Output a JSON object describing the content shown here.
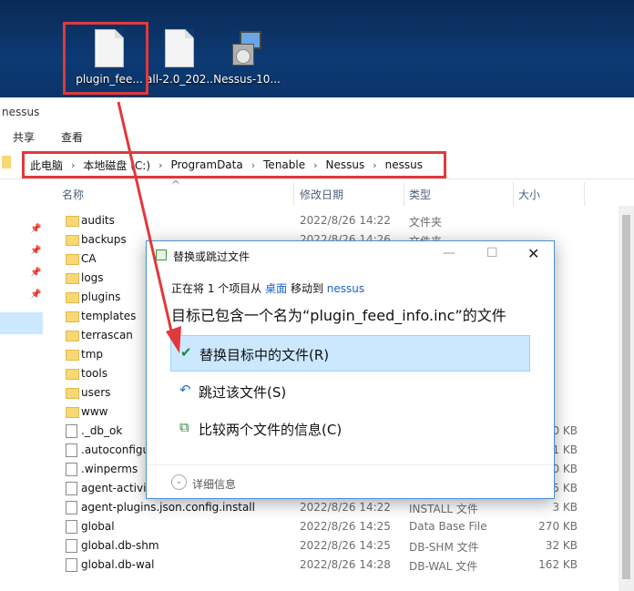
{
  "desktop": {
    "icons": [
      {
        "label": "plugin_fee..."
      },
      {
        "label": "all-2.0_202..."
      },
      {
        "label": "Nessus-10..."
      }
    ]
  },
  "explorer": {
    "window_title_partial": "nessus",
    "ribbon_tabs": [
      "共享",
      "查看"
    ],
    "breadcrumb": [
      "此电脑",
      "本地磁盘 (C:)",
      "ProgramData",
      "Tenable",
      "Nessus",
      "nessus"
    ],
    "columns": {
      "name": "名称",
      "date": "修改日期",
      "type": "类型",
      "size": "大小"
    },
    "rows": [
      {
        "name": "audits",
        "date": "2022/8/26 14:22",
        "type": "文件夹",
        "size": "",
        "kind": "folder"
      },
      {
        "name": "backups",
        "date": "2022/8/26 14:26",
        "type": "文件夹",
        "size": "",
        "kind": "folder"
      },
      {
        "name": "CA",
        "date": "",
        "type": "",
        "size": "",
        "kind": "folder"
      },
      {
        "name": "logs",
        "date": "",
        "type": "",
        "size": "",
        "kind": "folder"
      },
      {
        "name": "plugins",
        "date": "",
        "type": "",
        "size": "",
        "kind": "folder"
      },
      {
        "name": "templates",
        "date": "",
        "type": "",
        "size": "",
        "kind": "folder"
      },
      {
        "name": "terrascan",
        "date": "",
        "type": "",
        "size": "",
        "kind": "folder"
      },
      {
        "name": "tmp",
        "date": "",
        "type": "",
        "size": "",
        "kind": "folder"
      },
      {
        "name": "tools",
        "date": "",
        "type": "",
        "size": "",
        "kind": "folder"
      },
      {
        "name": "users",
        "date": "",
        "type": "",
        "size": "",
        "kind": "folder"
      },
      {
        "name": "www",
        "date": "",
        "type": "",
        "size": "",
        "kind": "folder"
      },
      {
        "name": "._db_ok",
        "date": "",
        "type": "",
        "size": "0 KB",
        "kind": "doc"
      },
      {
        "name": ".autoconfigu",
        "date": "",
        "type": "",
        "size": "1 KB",
        "kind": "doc"
      },
      {
        "name": ".winperms",
        "date": "",
        "type": "",
        "size": "0 KB",
        "kind": "doc"
      },
      {
        "name": "agent-activit",
        "date": "",
        "type": "",
        "size": "5 KB",
        "kind": "doc"
      },
      {
        "name": "agent-plugins.json.config.install",
        "date": "2022/8/26 14:22",
        "type": "INSTALL 文件",
        "size": "3 KB",
        "kind": "doc"
      },
      {
        "name": "global",
        "date": "2022/8/26 14:25",
        "type": "Data Base File",
        "size": "270 KB",
        "kind": "doc"
      },
      {
        "name": "global.db-shm",
        "date": "2022/8/26 14:25",
        "type": "DB-SHM 文件",
        "size": "32 KB",
        "kind": "doc"
      },
      {
        "name": "global.db-wal",
        "date": "2022/8/26 14:28",
        "type": "DB-WAL 文件",
        "size": "162 KB",
        "kind": "doc"
      }
    ]
  },
  "dialog": {
    "title": "替换或跳过文件",
    "line_prefix": "正在将 1 个项目从",
    "source": "桌面",
    "line_middle": "移动到",
    "destination": "nessus",
    "heading": "目标已包含一个名为“plugin_feed_info.inc”的文件",
    "options": [
      {
        "label": "替换目标中的文件(R)",
        "icon": "check-icon"
      },
      {
        "label": "跳过该文件(S)",
        "icon": "skip-icon"
      },
      {
        "label": "比较两个文件的信息(C)",
        "icon": "compare-icon"
      }
    ],
    "details": "详细信息"
  },
  "colors": {
    "annotation": "#e0393c",
    "selection": "#cce8ff",
    "link": "#1a62c7"
  }
}
